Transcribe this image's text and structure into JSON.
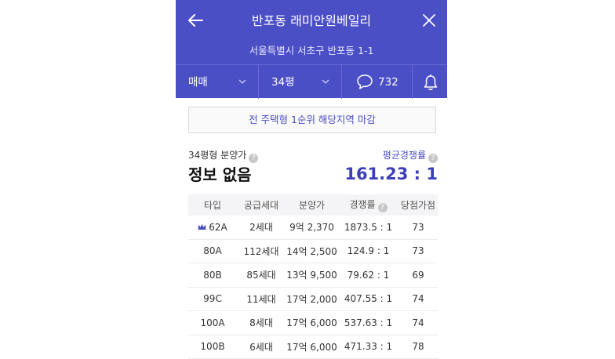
{
  "header": {
    "title": "반포동 래미안원베일리",
    "address": "서울특별시 서초구 반포동 1-1"
  },
  "tabs": {
    "deal": "매매",
    "size": "34평",
    "comment_count": "732"
  },
  "notice": "전 주택형 1순위 해당지역 마감",
  "summary": {
    "price_label": "34평형 분양가",
    "price_value": "정보 없음",
    "rate_label": "평균경쟁률",
    "rate_value": "161.23 : 1"
  },
  "table": {
    "headers": [
      "타입",
      "공급세대",
      "분양가",
      "경쟁률",
      "당첨가점"
    ],
    "rows": [
      [
        "62A",
        "2세대",
        "9억 2,370",
        "1873.5 : 1",
        "73"
      ],
      [
        "80A",
        "112세대",
        "14억 2,500",
        "124.9 : 1",
        "73"
      ],
      [
        "80B",
        "85세대",
        "13억 9,500",
        "79.62 : 1",
        "69"
      ],
      [
        "99C",
        "11세대",
        "17억 2,000",
        "407.55 : 1",
        "74"
      ],
      [
        "100A",
        "8세대",
        "17억 6,000",
        "537.63 : 1",
        "74"
      ],
      [
        "100B",
        "6세대",
        "17억 6,000",
        "471.33 : 1",
        "78"
      ]
    ]
  },
  "colors": {
    "header_bg": "#4b4fc6",
    "accent": "#3d3fb8",
    "crown": "#4a4fc0"
  },
  "icons": {
    "back": "arrow-left-icon",
    "close": "close-icon",
    "comment": "speech-bubble-icon",
    "alarm": "bell-icon",
    "help": "question-circle-icon",
    "crown": "crown-icon"
  }
}
